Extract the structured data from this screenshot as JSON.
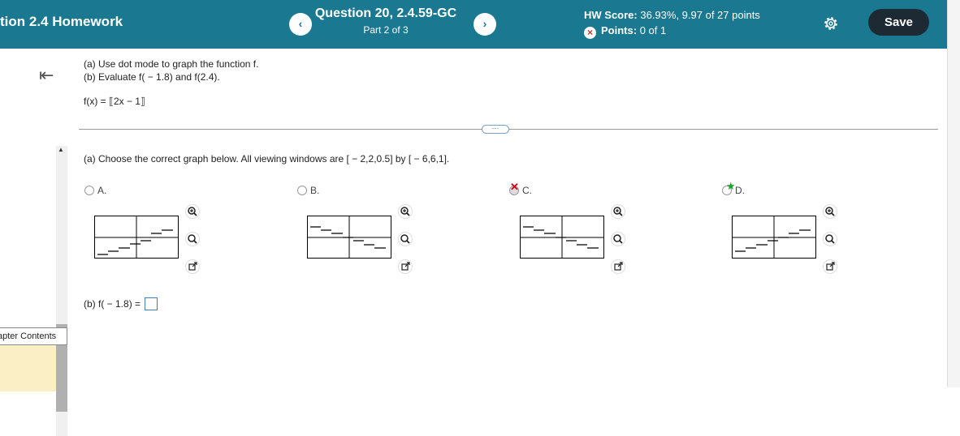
{
  "header": {
    "title": "tion 2.4 Homework",
    "prev_label": "‹",
    "next_label": "›",
    "question_title": "Question 20, 2.4.59-GC",
    "question_part": "Part 2 of 3",
    "hw_score_label": "HW Score:",
    "hw_score_value": "36.93%, 9.97 of 27 points",
    "points_label": "Points:",
    "points_value": "0 of 1",
    "settings_icon": "gear-icon",
    "save_label": "Save"
  },
  "sidebar": {
    "collapse_icon": "collapse-left-icon",
    "chapter_contents_label": "apter Contents"
  },
  "problem": {
    "instruction_a": "(a) Use dot mode to graph the function f.",
    "instruction_b": "(b) Evaluate f( − 1.8) and f(2.4).",
    "function": "f(x) = ⟦2x − 1⟧",
    "expand_label": "···",
    "part_a_prompt": "(a) Choose the correct graph below. All viewing windows are [ − 2,2,0.5] by [ − 6,6,1].",
    "options": [
      {
        "label": "A.",
        "status": "none"
      },
      {
        "label": "B.",
        "status": "none"
      },
      {
        "label": "C.",
        "status": "incorrect"
      },
      {
        "label": "D.",
        "status": "correct"
      }
    ],
    "part_b_prompt": "(b) f( − 1.8) = ",
    "part_b_value": ""
  },
  "colors": {
    "header_bg": "#1a7891",
    "save_bg": "#1e2a33",
    "incorrect": "#d0021b",
    "correct": "#1aa32a",
    "chapter_panel": "#fbefc6"
  }
}
